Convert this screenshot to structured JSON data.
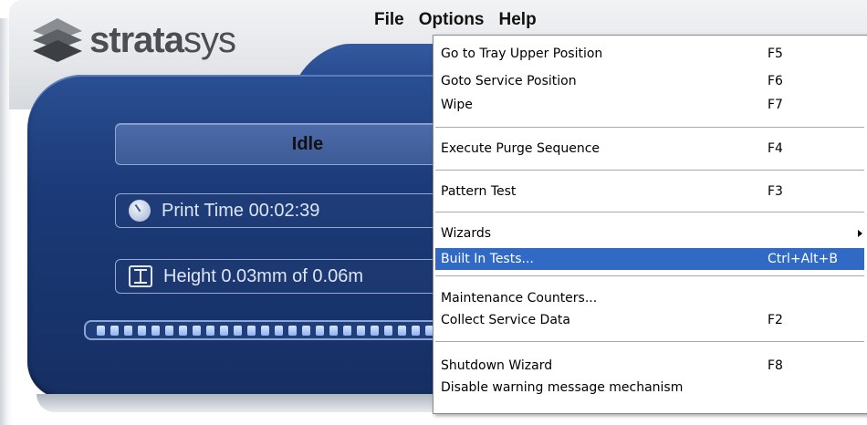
{
  "app": {
    "logo_bold": "strata",
    "logo_light": "sys"
  },
  "menubar": {
    "file": "File",
    "options": "Options",
    "help": "Help"
  },
  "status": {
    "state": "Idle"
  },
  "fields": {
    "print_time": "Print Time 00:02:39",
    "height": "Height 0.03mm of 0.06m"
  },
  "progress": {
    "segments": 25
  },
  "options_menu": {
    "items": [
      {
        "label": "Go to Tray Upper Position",
        "shortcut": "F5"
      },
      {
        "label": "Goto Service Position",
        "shortcut": "F6"
      },
      {
        "label": "Wipe",
        "shortcut": "F7"
      },
      {
        "label": "Execute Purge Sequence",
        "shortcut": "F4"
      },
      {
        "label": "Pattern Test",
        "shortcut": "F3"
      },
      {
        "label": "Wizards",
        "shortcut": ""
      },
      {
        "label": "Built In Tests...",
        "shortcut": "Ctrl+Alt+B"
      },
      {
        "label": "Maintenance Counters...",
        "shortcut": ""
      },
      {
        "label": "Collect Service Data",
        "shortcut": "F2"
      },
      {
        "label": "Shutdown Wizard",
        "shortcut": "F8"
      },
      {
        "label": "Disable warning message mechanism",
        "shortcut": ""
      }
    ]
  },
  "colors": {
    "selection": "#316ac5",
    "panel_blue": "#1b3a78"
  }
}
